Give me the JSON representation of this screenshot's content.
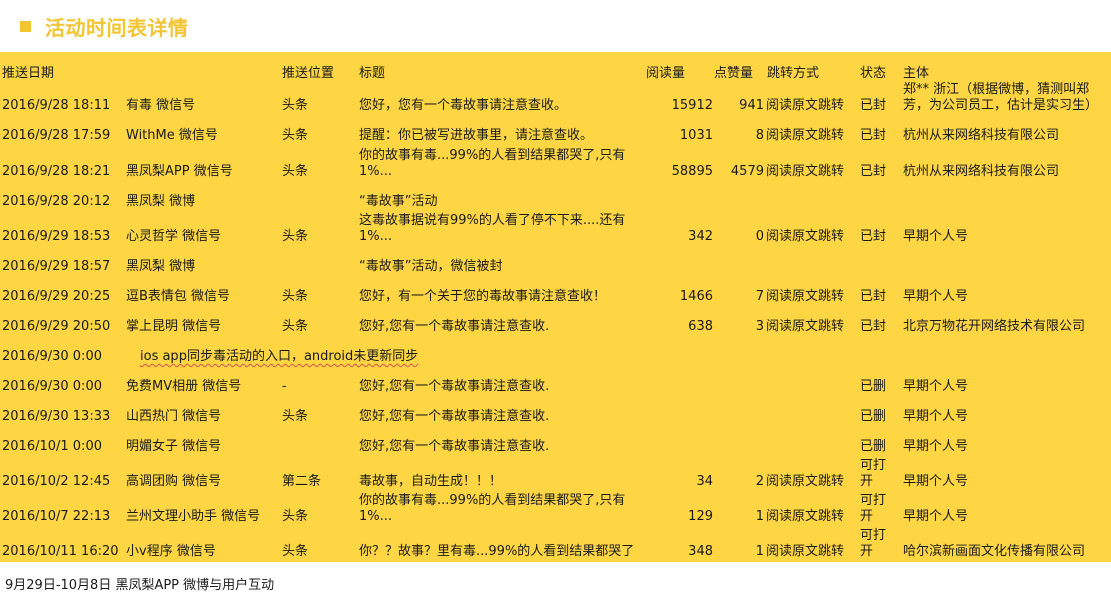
{
  "page": {
    "title": "活动时间表详情",
    "accent_color": "#f2c531",
    "panel_color": "#fed644"
  },
  "table": {
    "headers": {
      "date": "推送日期",
      "position": "推送位置",
      "headline": "标题",
      "reads": "阅读量",
      "likes": "点赞量",
      "jump": "跳转方式",
      "status": "状态",
      "subject": "主体"
    },
    "rows": [
      {
        "date": "2016/9/28 18:11",
        "account": "有毒 微信号",
        "position": "头条",
        "headline": "您好，您有一个毒故事请注意查收。",
        "reads": "15912",
        "likes": "941",
        "jump": "阅读原文跳转",
        "status": "已封",
        "subject": "郑** 浙江（根据微博，猜测叫郑芳，为公司员工，估计是实习生）"
      },
      {
        "date": "2016/9/28 17:59",
        "account": "WithMe 微信号",
        "position": "头条",
        "headline": "提醒：你已被写进故事里，请注意查收。",
        "reads": "1031",
        "likes": "8",
        "jump": "阅读原文跳转",
        "status": "已封",
        "subject": "杭州从来网络科技有限公司"
      },
      {
        "date": "2016/9/28 18:21",
        "account": "黑凤梨APP 微信号",
        "position": "头条",
        "headline": "你的故事有毒...99%的人看到结果都哭了,只有1%...",
        "reads": "58895",
        "likes": "4579",
        "jump": "阅读原文跳转",
        "status": "已封",
        "subject": "杭州从来网络科技有限公司"
      },
      {
        "date": "2016/9/28 20:12",
        "account": "黑凤梨 微博",
        "position": "",
        "headline": "“毒故事”活动",
        "reads": "",
        "likes": "",
        "jump": "",
        "status": "",
        "subject": ""
      },
      {
        "date": "2016/9/29 18:53",
        "account": "心灵哲学 微信号",
        "position": "头条",
        "headline": "这毒故事据说有99%的人看了停不下来....还有1%...",
        "reads": "342",
        "likes": "0",
        "jump": "阅读原文跳转",
        "status": "已封",
        "subject": "早期个人号"
      },
      {
        "date": "2016/9/29 18:57",
        "account": "黑凤梨 微博",
        "position": "",
        "headline": "“毒故事”活动，微信被封",
        "reads": "",
        "likes": "",
        "jump": "",
        "status": "",
        "subject": ""
      },
      {
        "date": "2016/9/29 20:25",
        "account": "逗B表情包 微信号",
        "position": "头条",
        "headline": "您好，有一个关于您的毒故事请注意查收！",
        "reads": "1466",
        "likes": "7",
        "jump": "阅读原文跳转",
        "status": "已封",
        "subject": "早期个人号"
      },
      {
        "date": "2016/9/29 20:50",
        "account": "掌上昆明 微信号",
        "position": "头条",
        "headline": "您好,您有一个毒故事请注意查收.",
        "reads": "638",
        "likes": "3",
        "jump": "阅读原文跳转",
        "status": "已封",
        "subject": "北京万物花开网络技术有限公司"
      },
      {
        "date": "2016/9/30 0:00",
        "account": "",
        "position": "",
        "headline": "",
        "reads": "",
        "likes": "",
        "jump": "",
        "status": "",
        "subject": "",
        "note": "ios app同步毒活动的入口，android未更新同步"
      },
      {
        "date": "2016/9/30 0:00",
        "account": "免费MV相册 微信号",
        "position": "-",
        "headline": "您好,您有一个毒故事请注意查收.",
        "reads": "",
        "likes": "",
        "jump": "",
        "status": "已删",
        "subject": "早期个人号"
      },
      {
        "date": "2016/9/30 13:33",
        "account": "山西热门 微信号",
        "position": "头条",
        "headline": "您好,您有一个毒故事请注意查收.",
        "reads": "",
        "likes": "",
        "jump": "",
        "status": "已删",
        "subject": "早期个人号"
      },
      {
        "date": "2016/10/1 0:00",
        "account": "明媚女子 微信号",
        "position": "",
        "headline": "您好,您有一个毒故事请注意查收.",
        "reads": "",
        "likes": "",
        "jump": "",
        "status": "已删",
        "subject": "早期个人号"
      },
      {
        "date": "2016/10/2 12:45",
        "account": "高调团购 微信号",
        "position": "第二条",
        "headline": "毒故事，自动生成！！！",
        "reads": "34",
        "likes": "2",
        "jump": "阅读原文跳转",
        "status": "可打开",
        "subject": "早期个人号"
      },
      {
        "date": "2016/10/7 22:13",
        "account": "兰州文理小助手 微信号",
        "position": "头条",
        "headline": "你的故事有毒...99%的人看到结果都哭了,只有1%...",
        "reads": "129",
        "likes": "1",
        "jump": "阅读原文跳转",
        "status": "可打开",
        "subject": "早期个人号"
      },
      {
        "date": "2016/10/11 16:20",
        "account": "小v程序 微信号",
        "position": "头条",
        "headline": "你？？故事？里有毒...99%的人看到结果都哭了",
        "reads": "348",
        "likes": "1",
        "jump": "阅读原文跳转",
        "status": "可打开",
        "subject": "哈尔滨新画面文化传播有限公司"
      }
    ]
  },
  "footer": {
    "note": "9月29日-10月8日 黑凤梨APP 微博与用户互动"
  }
}
